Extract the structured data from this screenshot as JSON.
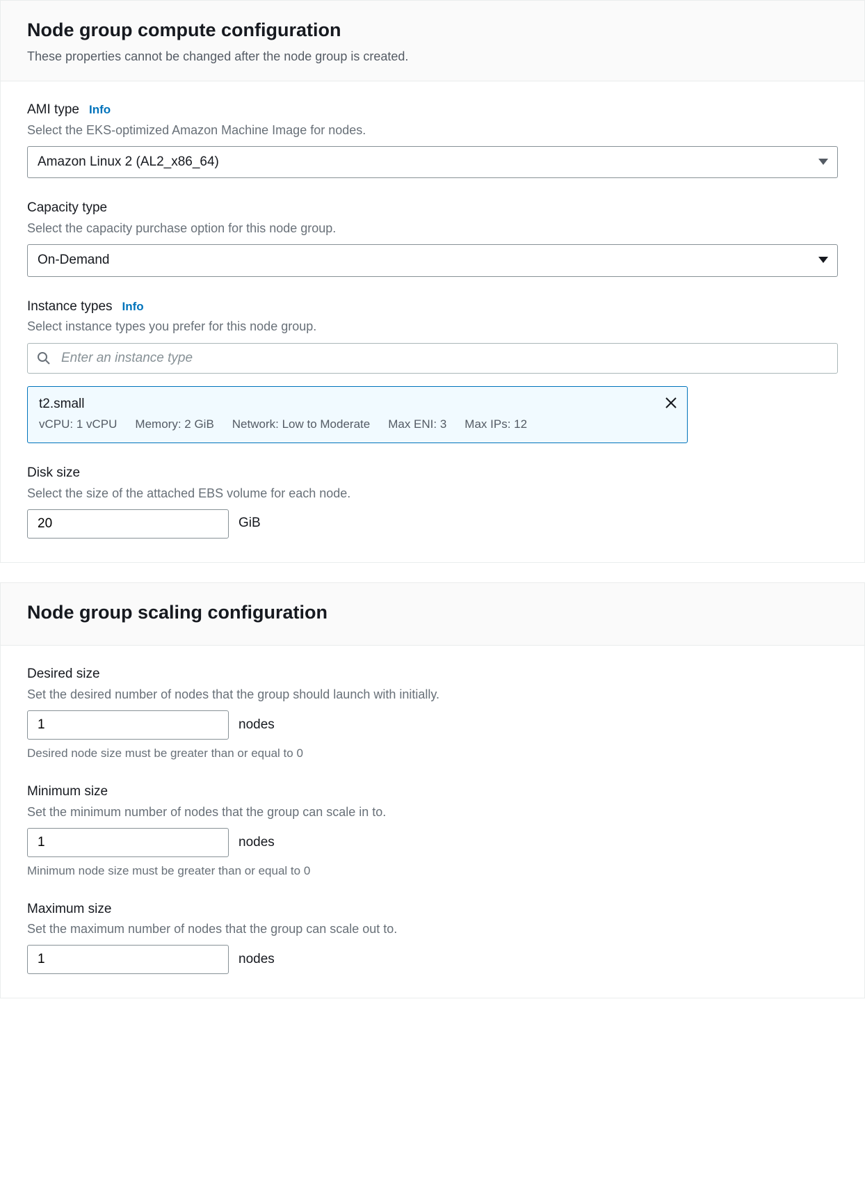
{
  "compute": {
    "title": "Node group compute configuration",
    "subtitle": "These properties cannot be changed after the node group is created.",
    "ami": {
      "label": "AMI type",
      "info": "Info",
      "desc": "Select the EKS-optimized Amazon Machine Image for nodes.",
      "value": "Amazon Linux 2 (AL2_x86_64)"
    },
    "capacity": {
      "label": "Capacity type",
      "desc": "Select the capacity purchase option for this node group.",
      "value": "On-Demand"
    },
    "instance": {
      "label": "Instance types",
      "info": "Info",
      "desc": "Select instance types you prefer for this node group.",
      "placeholder": "Enter an instance type",
      "token": {
        "name": "t2.small",
        "vcpu": "vCPU: 1 vCPU",
        "memory": "Memory: 2 GiB",
        "network": "Network: Low to Moderate",
        "max_eni": "Max ENI: 3",
        "max_ips": "Max IPs: 12"
      }
    },
    "disk": {
      "label": "Disk size",
      "desc": "Select the size of the attached EBS volume for each node.",
      "value": "20",
      "unit": "GiB"
    }
  },
  "scaling": {
    "title": "Node group scaling configuration",
    "desired": {
      "label": "Desired size",
      "desc": "Set the desired number of nodes that the group should launch with initially.",
      "value": "1",
      "unit": "nodes",
      "hint": "Desired node size must be greater than or equal to 0"
    },
    "minimum": {
      "label": "Minimum size",
      "desc": "Set the minimum number of nodes that the group can scale in to.",
      "value": "1",
      "unit": "nodes",
      "hint": "Minimum node size must be greater than or equal to 0"
    },
    "maximum": {
      "label": "Maximum size",
      "desc": "Set the maximum number of nodes that the group can scale out to.",
      "value": "1",
      "unit": "nodes"
    }
  }
}
